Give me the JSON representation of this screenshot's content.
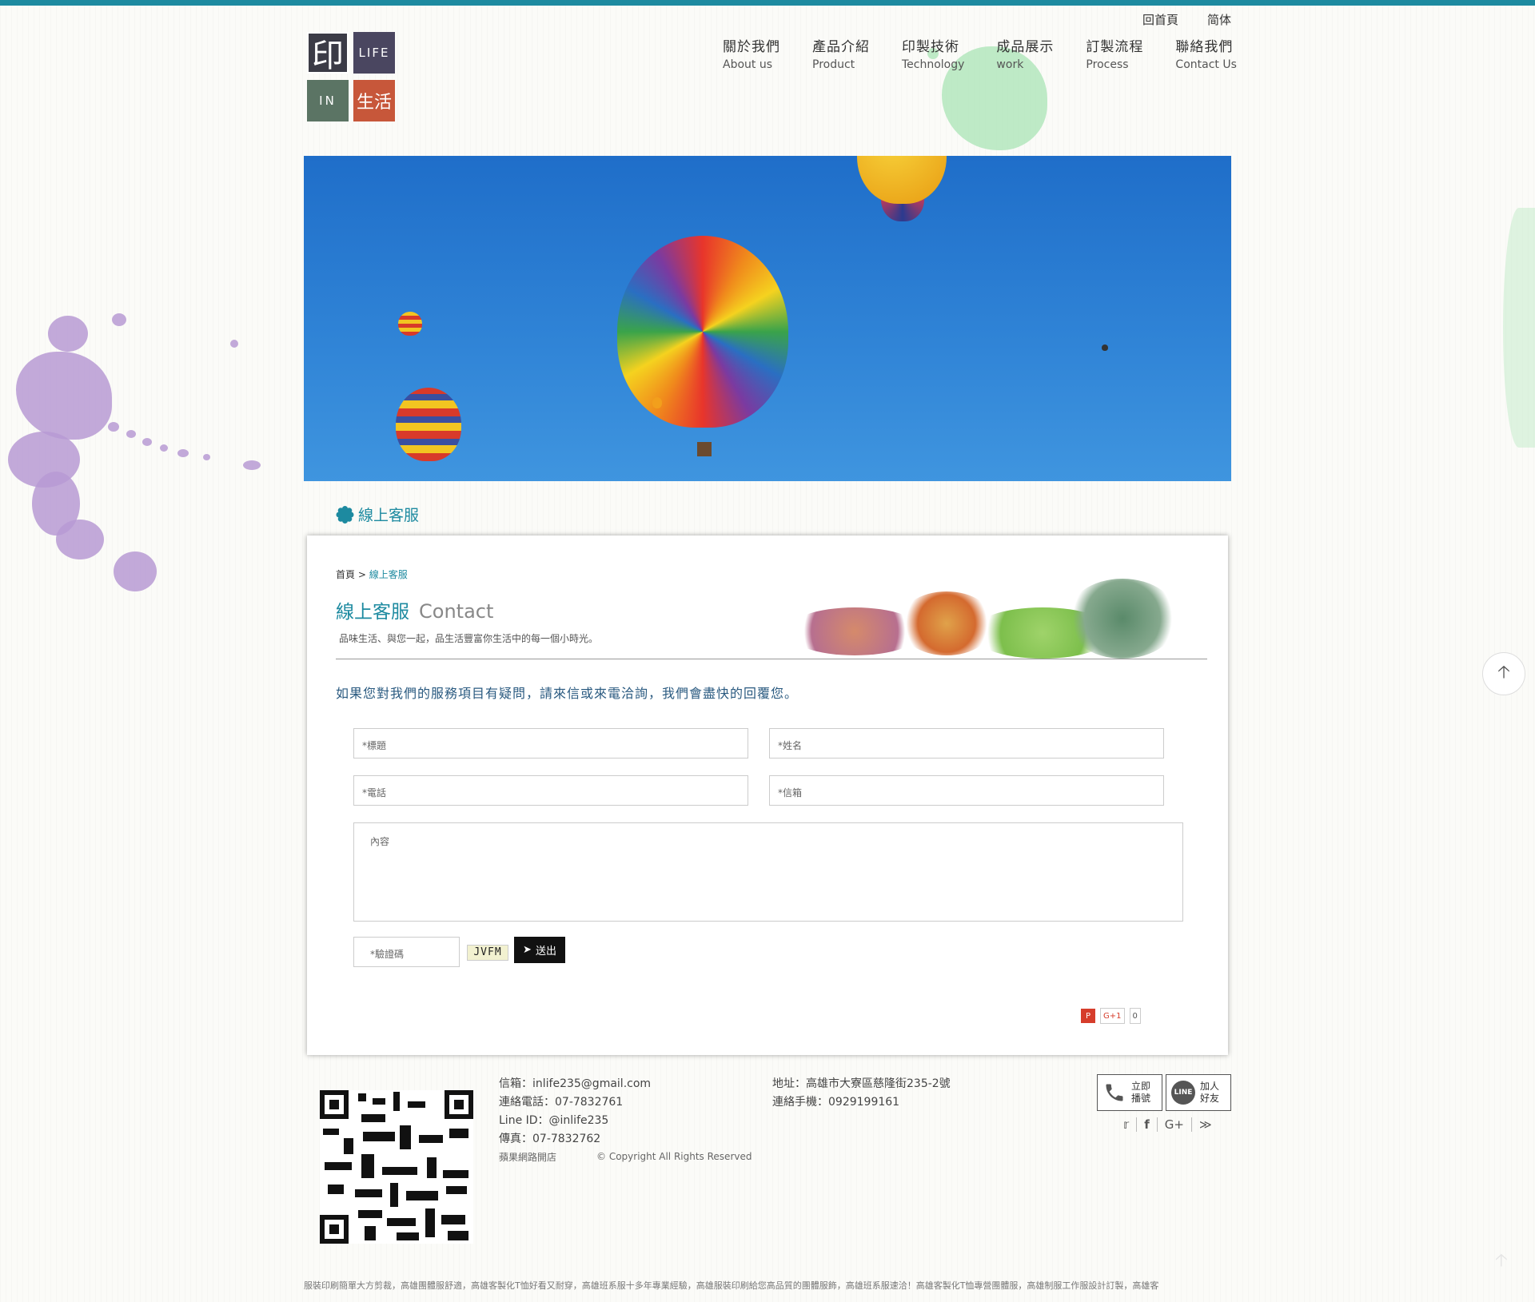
{
  "header": {
    "logo": {
      "tile1": "印",
      "tile2": "LIFE",
      "tile3": "IN",
      "tile4": "生活"
    },
    "top_links": [
      "回首頁",
      "简体"
    ],
    "nav": [
      {
        "zh": "關於我們",
        "en": "About us"
      },
      {
        "zh": "產品介紹",
        "en": "Product"
      },
      {
        "zh": "印製技術",
        "en": "Technology"
      },
      {
        "zh": "成品展示",
        "en": "work"
      },
      {
        "zh": "訂製流程",
        "en": "Process"
      },
      {
        "zh": "聯絡我們",
        "en": "Contact Us"
      }
    ]
  },
  "section_title": "線上客服",
  "contact": {
    "breadcrumb_home": "首頁",
    "breadcrumb_sep": ">",
    "breadcrumb_current": "線上客服",
    "title_zh": "線上客服",
    "title_en": "Contact",
    "subtitle": "品味生活、與您一起，品生活豐富你生活中的每一個小時光。",
    "description": "如果您對我們的服務項目有疑問，請來信或來電洽詢，我們會盡快的回覆您。",
    "fields": {
      "subject": "*標題",
      "name": "*姓名",
      "phone": "*電話",
      "email": "*信箱",
      "content": "內容",
      "captcha": "*驗證碼"
    },
    "captcha_code": "JVFM",
    "submit_label": "送出",
    "gplus_label": "G+1",
    "gplus_count": "0"
  },
  "footer": {
    "email": "信箱：inlife235@gmail.com",
    "tel": "連絡電話：07-7832761",
    "line_id": "Line ID：@inlife235",
    "fax": "傳真：07-7832762",
    "store": "蘋果網路開店",
    "copyright": "© Copyright All Rights Reserved",
    "address": "地址：高雄市大寮區慈隆街235-2號",
    "mobile": "連絡手機：0929199161",
    "call_label_1": "立即",
    "call_label_2": "播號",
    "line_label_1": "加人",
    "line_label_2": "好友",
    "line_badge": "LINE",
    "seo_text": "服裝印刷簡單大方剪裁，高雄團體服舒適，高雄客製化T恤好看又耐穿，高雄班系服十多年專業經驗，高雄服裝印刷給您高品質的團體服飾，高雄班系服速洽！高雄客製化T恤專營團體服，高雄制服工作服設計訂製，高雄客"
  },
  "colors": {
    "accent": "#1d8aa0",
    "topbar": "#1d8aa0",
    "logo_red": "#c7573a",
    "logo_green": "#5b7464",
    "logo_dark": "#3b3b46"
  }
}
